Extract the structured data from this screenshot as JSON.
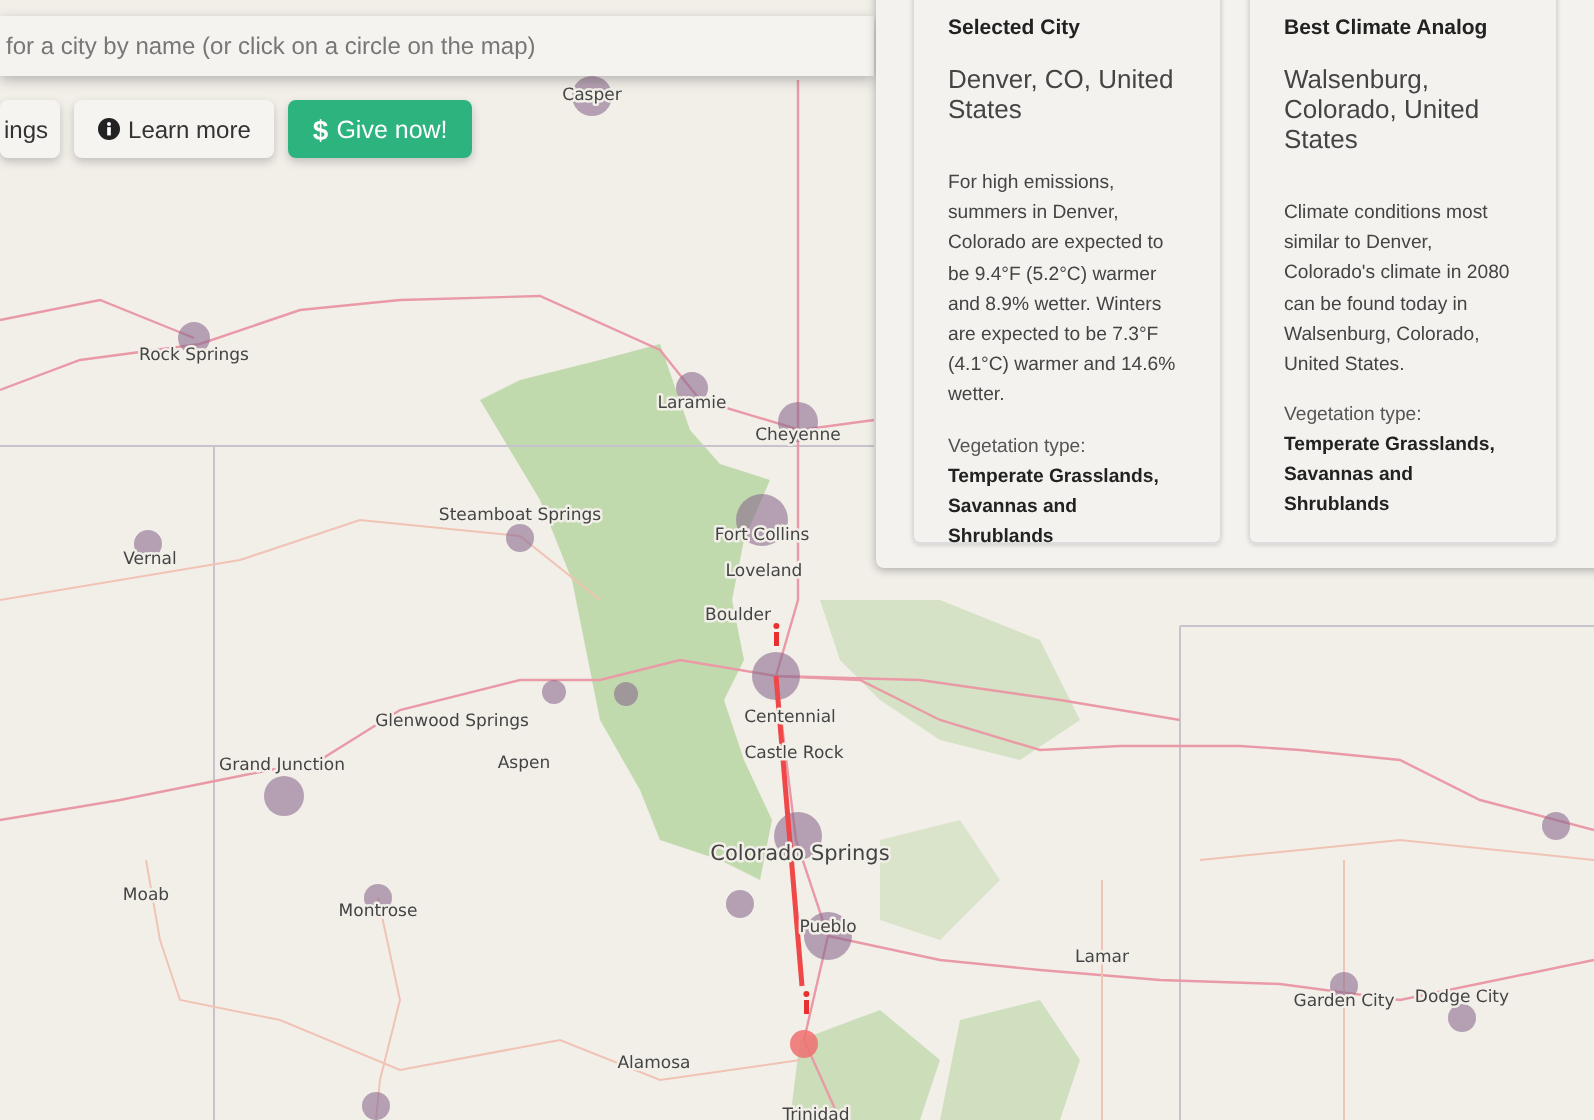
{
  "search": {
    "placeholder": "for a city by name (or click on a circle on the map)"
  },
  "buttons": [
    {
      "kind": "plain",
      "label": "ings"
    },
    {
      "kind": "info",
      "label": "Learn more"
    },
    {
      "kind": "give",
      "icon": "$",
      "label": "Give now!"
    }
  ],
  "cards": [
    {
      "title": "Selected City",
      "city": "Denver, CO, United States",
      "description": "For high emissions, summers in Denver, Colorado are expected to be 9.4°F (5.2°C) warmer and 8.9% wetter. Winters are expected to be 7.3°F (4.1°C) warmer and 14.6% wetter.",
      "vegetation_label": "Vegetation type:",
      "vegetation": "Temperate Grasslands, Savannas and Shrublands"
    },
    {
      "title": "Best Climate Analog",
      "city": "Walsenburg, Colorado, United States",
      "description": "Climate conditions most similar to Denver, Colorado's climate in 2080 can be found today in Walsenburg, Colorado, United States.",
      "vegetation_label": "Vegetation type:",
      "vegetation": "Temperate Grasslands, Savannas and Shrublands"
    }
  ],
  "map": {
    "labels": [
      "Casper",
      "Rock Springs",
      "Laramie",
      "Cheyenne",
      "Steamboat Springs",
      "Vernal",
      "Fort Collins",
      "Loveland",
      "Boulder",
      "Centennial",
      "Castle Rock",
      "Glenwood Springs",
      "Aspen",
      "Grand Junction",
      "Colorado Springs",
      "Moab",
      "Montrose",
      "Pueblo",
      "Lamar",
      "Garden City",
      "Dodge City",
      "Alamosa",
      "Trinidad"
    ]
  }
}
